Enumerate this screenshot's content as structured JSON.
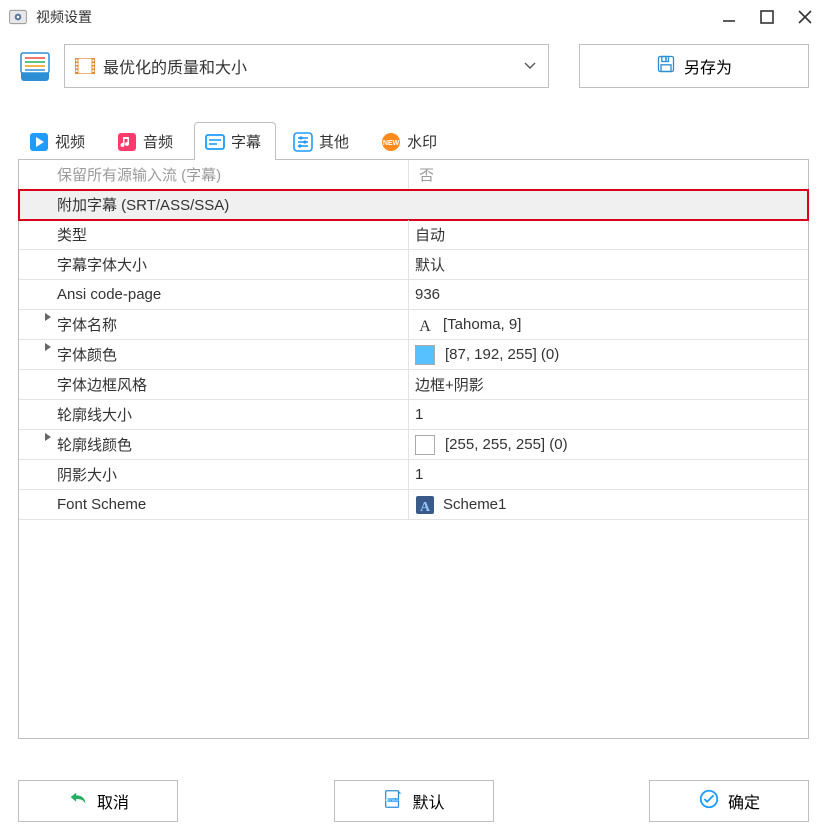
{
  "window": {
    "title": "视频设置"
  },
  "profile": {
    "label": "最优化的质量和大小"
  },
  "buttons": {
    "saveAs": "另存为",
    "cancel": "取消",
    "default": "默认",
    "ok": "确定"
  },
  "tabs": {
    "video": "视频",
    "audio": "音频",
    "subtitle": "字幕",
    "other": "其他",
    "watermark": "水印",
    "activeIndex": 2
  },
  "table": {
    "headerL": "保留所有源输入流 (字幕)",
    "headerR": "否",
    "rows": [
      {
        "label": "附加字幕 (SRT/ASS/SSA)",
        "value": "",
        "highlight": true
      },
      {
        "label": "类型",
        "value": "自动"
      },
      {
        "label": "字幕字体大小",
        "value": "默认"
      },
      {
        "label": "Ansi code-page",
        "value": "936"
      },
      {
        "label": "字体名称",
        "value": "[Tahoma, 9]",
        "expander": true,
        "iconA": true
      },
      {
        "label": "字体颜色",
        "value": "[87, 192, 255] (0)",
        "expander": true,
        "swatch": "#57c0ff"
      },
      {
        "label": "字体边框风格",
        "value": "边框+阴影"
      },
      {
        "label": "轮廓线大小",
        "value": "1"
      },
      {
        "label": "轮廓线颜色",
        "value": "[255, 255, 255] (0)",
        "expander": true,
        "swatch": "#ffffff"
      },
      {
        "label": "阴影大小",
        "value": "1"
      },
      {
        "label": "Font Scheme",
        "value": "Scheme1",
        "schemeIcon": true
      }
    ]
  },
  "icons": {
    "appIcon": "app-icon",
    "archive": "archive-icon",
    "film": "film-icon",
    "chevronDown": "chevron-down-icon"
  }
}
